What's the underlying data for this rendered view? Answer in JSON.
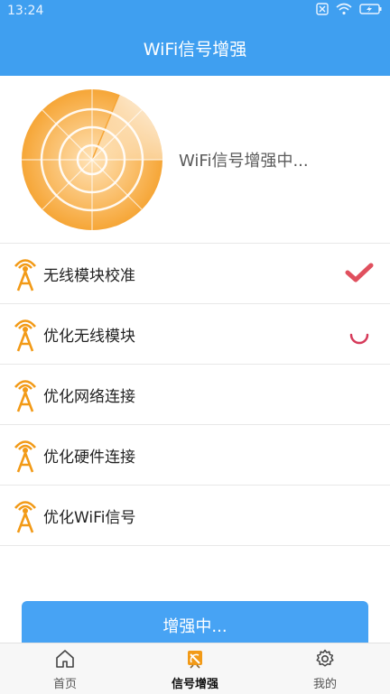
{
  "status_bar": {
    "time": "13:24"
  },
  "header": {
    "title": "WiFi信号增强"
  },
  "hero": {
    "status_text": "WiFi信号增强中..."
  },
  "rows": [
    {
      "label": "无线模块校准",
      "state": "done"
    },
    {
      "label": "优化无线模块",
      "state": "in-progress"
    },
    {
      "label": "优化网络连接",
      "state": "pending"
    },
    {
      "label": "优化硬件连接",
      "state": "pending"
    },
    {
      "label": "优化WiFi信号",
      "state": "pending"
    }
  ],
  "action_button": {
    "label": "增强中..."
  },
  "tabs": [
    {
      "label": "首页",
      "icon": "home-icon"
    },
    {
      "label": "信号增强",
      "icon": "signal-dish-icon",
      "active": true
    },
    {
      "label": "我的",
      "icon": "gear-icon"
    }
  ],
  "colors": {
    "header": "#3f9ff0",
    "accent_orange": "#f29a17",
    "check_red": "#e0505e",
    "button": "#47a3f4"
  }
}
